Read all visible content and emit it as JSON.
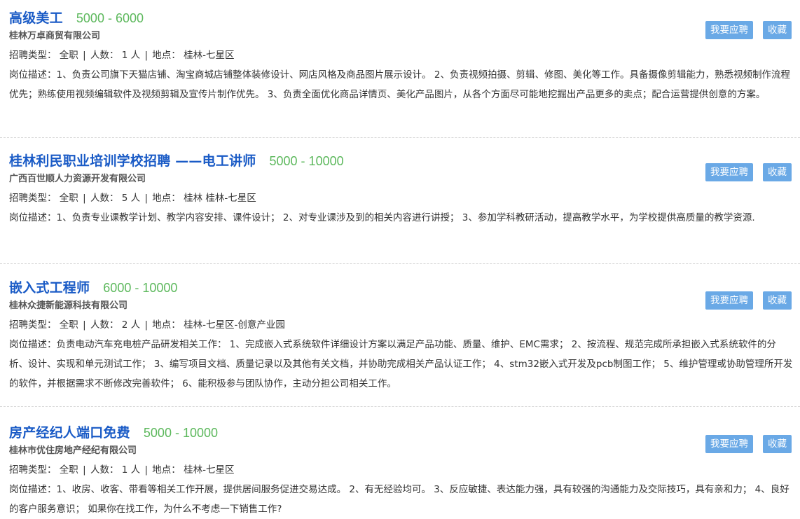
{
  "labels": {
    "type_label": "招聘类型：",
    "count_label": "人数：",
    "location_label": "地点：",
    "desc_label": "岗位描述：",
    "separator": "|",
    "apply_button": "我要应聘",
    "favorite_button": "收藏"
  },
  "jobs": [
    {
      "title": "高级美工",
      "salary": "5000 - 6000",
      "company": "桂林万卓商贸有限公司",
      "type": "全职",
      "count": "1 人",
      "location": "桂林-七星区",
      "description": "1、负责公司旗下天猫店铺、淘宝商城店铺整体装修设计、网店风格及商品图片展示设计。 2、负责视频拍摄、剪辑、修图、美化等工作。具备摄像剪辑能力，熟悉视频制作流程优先；熟练使用视频编辑软件及视频剪辑及宣传片制作优先。 3、负责全面优化商品详情页、美化产品图片，从各个方面尽可能地挖掘出产品更多的卖点；配合运营提供创意的方案。"
    },
    {
      "title": "桂林利民职业培训学校招聘 ——电工讲师",
      "salary": "5000 - 10000",
      "company": "广西百世顺人力资源开发有限公司",
      "type": "全职",
      "count": "5 人",
      "location": "桂林 桂林-七星区",
      "description": "1、负责专业课教学计划、教学内容安排、课件设计； 2、对专业课涉及到的相关内容进行讲授； 3、参加学科教研活动，提高教学水平，为学校提供高质量的教学资源."
    },
    {
      "title": "嵌入式工程师",
      "salary": "6000 - 10000",
      "company": "桂林众捷新能源科技有限公司",
      "type": "全职",
      "count": "2 人",
      "location": "桂林-七星区-创意产业园",
      "description": "负责电动汽车充电桩产品研发相关工作： 1、完成嵌入式系统软件详细设计方案以满足产品功能、质量、维护、EMC需求； 2、按流程、规范完成所承担嵌入式系统软件的分析、设计、实现和单元测试工作； 3、编写项目文档、质量记录以及其他有关文档，并协助完成相关产品认证工作； 4、stm32嵌入式开发及pcb制图工作； 5、维护管理或协助管理所开发的软件，并根据需求不断修改完善软件； 6、能积极参与团队协作，主动分担公司相关工作。"
    },
    {
      "title": "房产经纪人端口免费",
      "salary": "5000 - 10000",
      "company": "桂林市优住房地产经纪有限公司",
      "type": "全职",
      "count": "1 人",
      "location": "桂林-七星区",
      "description": "1、收房、收客、带看等相关工作开展，提供居间服务促进交易达成。 2、有无经验均可。 3、反应敏捷、表达能力强，具有较强的沟通能力及交际技巧，具有亲和力； 4、良好的客户服务意识； 如果你在找工作，为什么不考虑一下销售工作?"
    }
  ],
  "colors": {
    "title": "#1a5bc6",
    "salary": "#5cb85c",
    "button_bg": "#6aa9e6",
    "divider": "#d6d6d6"
  }
}
